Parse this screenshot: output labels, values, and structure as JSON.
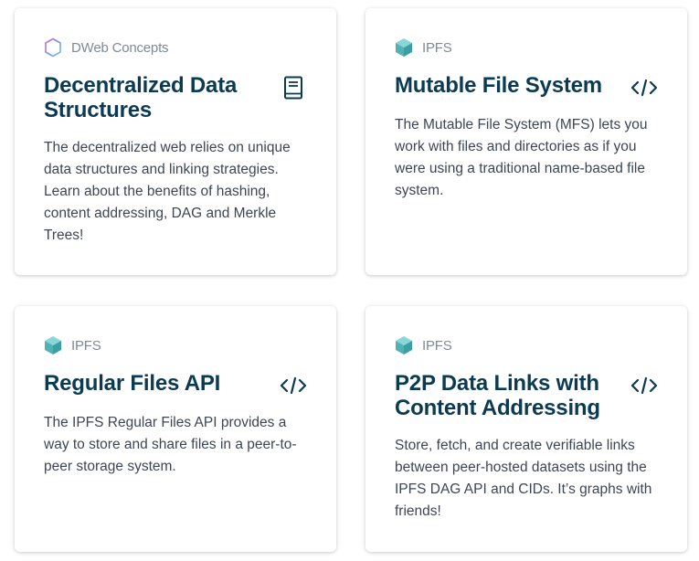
{
  "colors": {
    "title": "#0b3a53",
    "tag": "#7d8a98",
    "body": "#3d4652",
    "ipfs_cube_light": "#6cc5c7",
    "ipfs_cube_dark": "#3b9ea3"
  },
  "cards": [
    {
      "tag": "DWeb Concepts",
      "tag_icon": "hexagon-outline-icon",
      "title": "Decentralized Data Structures",
      "type_icon": "book-icon",
      "description": "The decentralized web relies on unique data structures and linking strategies. Learn about the benefits of hashing, content addressing, DAG and Merkle Trees!"
    },
    {
      "tag": "IPFS",
      "tag_icon": "ipfs-cube-icon",
      "title": "Mutable File System",
      "type_icon": "code-icon",
      "description": "The Mutable File System (MFS) lets you work with files and directories as if you were using a traditional name-based file system."
    },
    {
      "tag": "IPFS",
      "tag_icon": "ipfs-cube-icon",
      "title": "Regular Files API",
      "type_icon": "code-icon",
      "description": "The IPFS Regular Files API provides a way to store and share files in a peer-to-peer storage system."
    },
    {
      "tag": "IPFS",
      "tag_icon": "ipfs-cube-icon",
      "title": "P2P Data Links with Content Addressing",
      "type_icon": "code-icon",
      "description": "Store, fetch, and create verifiable links between peer-hosted datasets using the IPFS DAG API and CIDs. It’s graphs with friends!"
    }
  ]
}
